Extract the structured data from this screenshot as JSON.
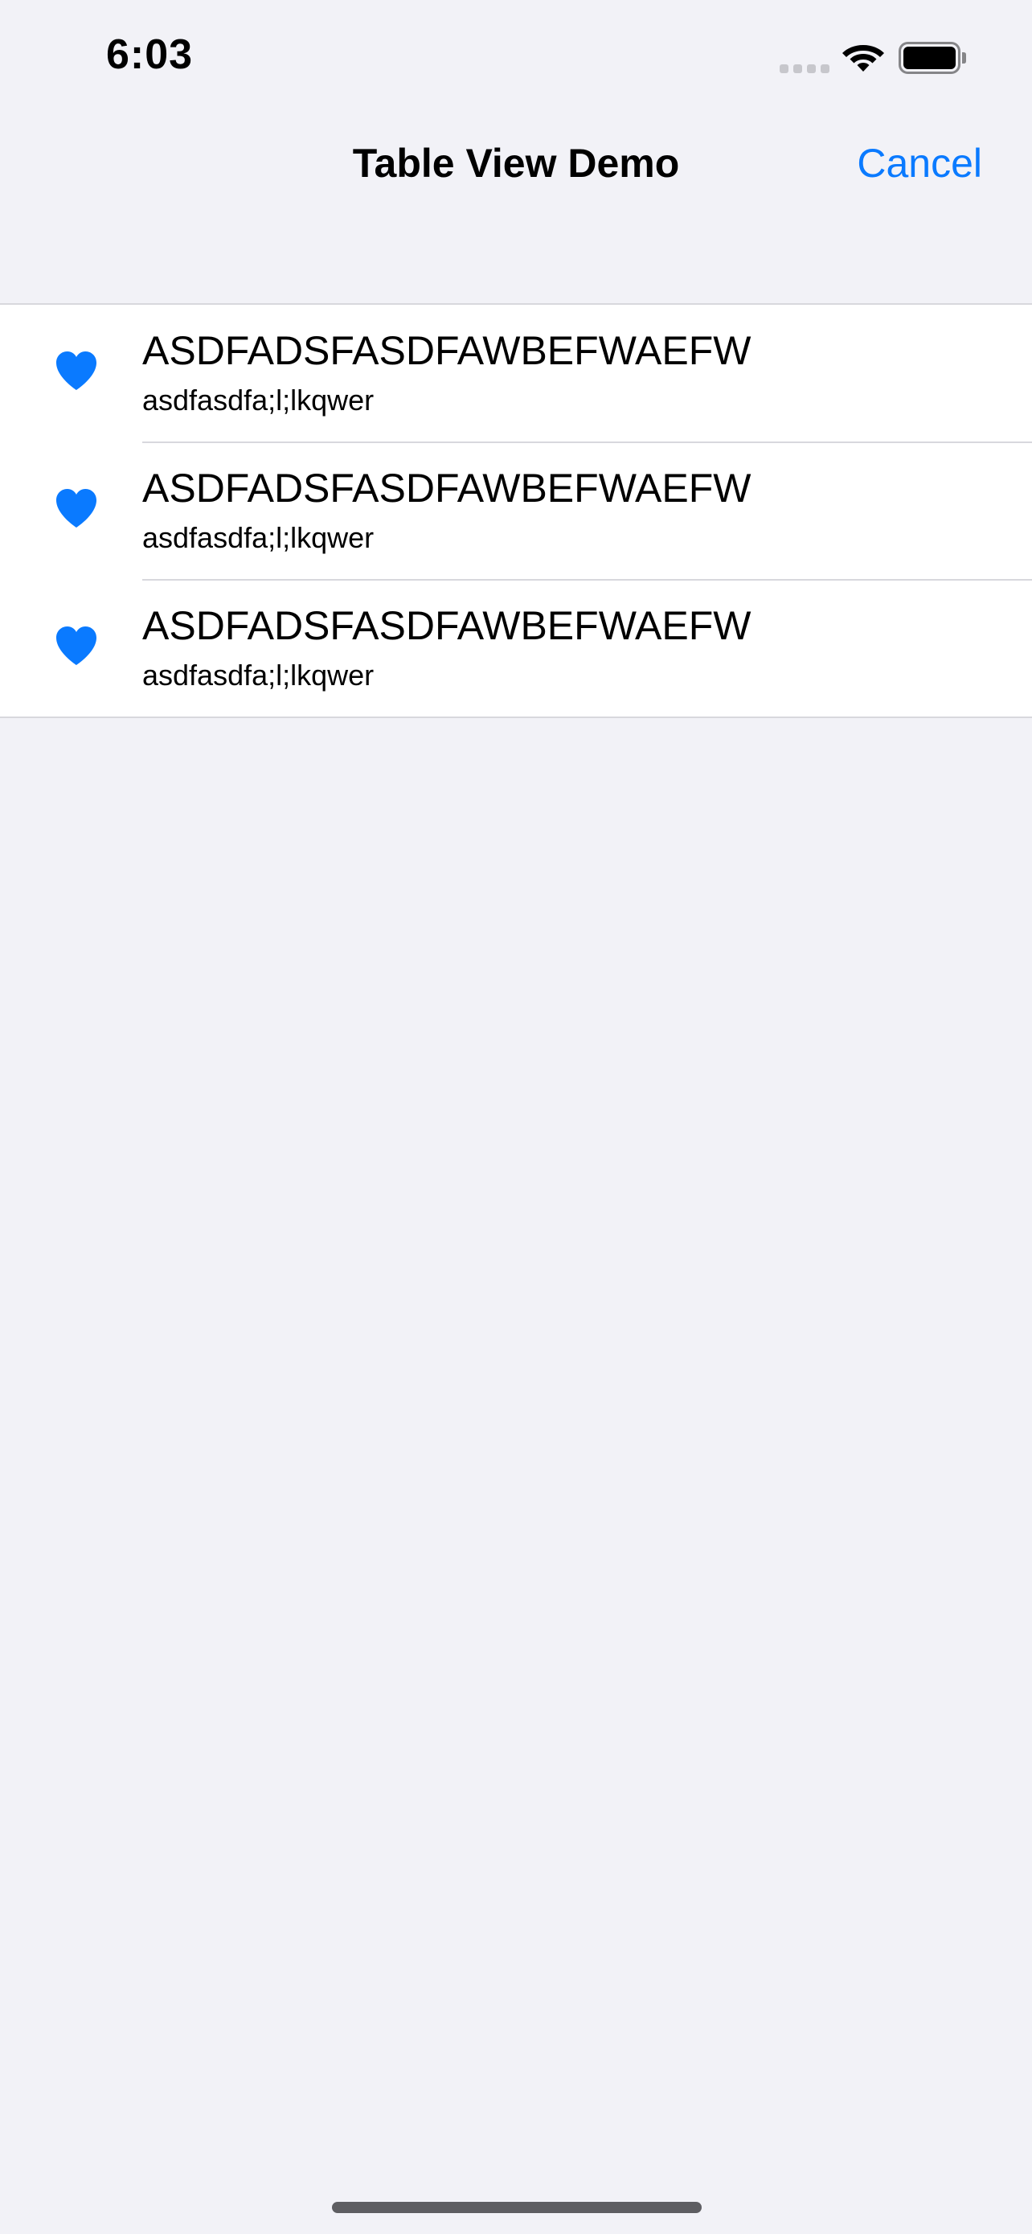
{
  "status_bar": {
    "time": "6:03",
    "icons": [
      "signal-dots-icon",
      "wifi-icon",
      "battery-icon"
    ]
  },
  "nav": {
    "title": "Table View Demo",
    "cancel_label": "Cancel"
  },
  "table": {
    "rows": [
      {
        "icon": "heart-icon",
        "title": "ASDFADSFASDFAWBEFWAEFW",
        "subtitle": "asdfasdfa;l;lkqwer"
      },
      {
        "icon": "heart-icon",
        "title": "ASDFADSFASDFAWBEFWAEFW",
        "subtitle": "asdfasdfa;l;lkqwer"
      },
      {
        "icon": "heart-icon",
        "title": "ASDFADSFASDFAWBEFWAEFW",
        "subtitle": "asdfasdfa;l;lkqwer"
      }
    ]
  },
  "colors": {
    "accent": "#0A7AFF",
    "background": "#F2F2F7",
    "cell": "#FFFFFF",
    "separator": "#D8D8DD"
  }
}
